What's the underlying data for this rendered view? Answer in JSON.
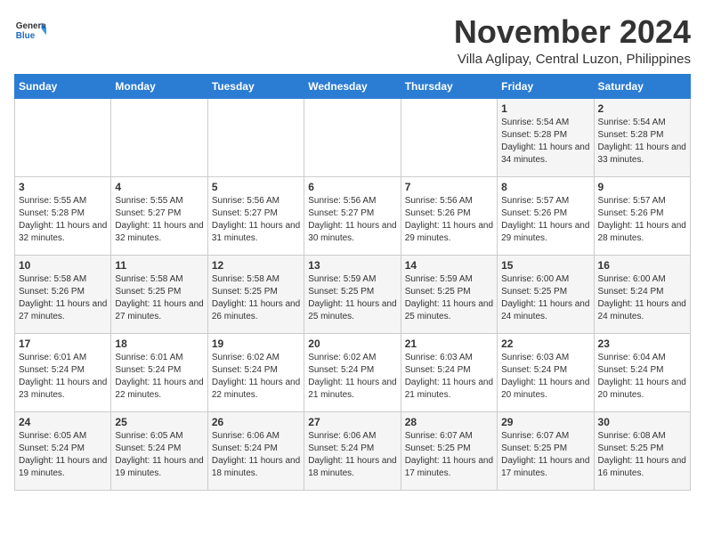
{
  "header": {
    "logo": {
      "general": "General",
      "blue": "Blue"
    },
    "title": "November 2024",
    "location": "Villa Aglipay, Central Luzon, Philippines"
  },
  "weekdays": [
    "Sunday",
    "Monday",
    "Tuesday",
    "Wednesday",
    "Thursday",
    "Friday",
    "Saturday"
  ],
  "weeks": [
    [
      {
        "day": "",
        "info": ""
      },
      {
        "day": "",
        "info": ""
      },
      {
        "day": "",
        "info": ""
      },
      {
        "day": "",
        "info": ""
      },
      {
        "day": "",
        "info": ""
      },
      {
        "day": "1",
        "info": "Sunrise: 5:54 AM\nSunset: 5:28 PM\nDaylight: 11 hours and 34 minutes."
      },
      {
        "day": "2",
        "info": "Sunrise: 5:54 AM\nSunset: 5:28 PM\nDaylight: 11 hours and 33 minutes."
      }
    ],
    [
      {
        "day": "3",
        "info": "Sunrise: 5:55 AM\nSunset: 5:28 PM\nDaylight: 11 hours and 32 minutes."
      },
      {
        "day": "4",
        "info": "Sunrise: 5:55 AM\nSunset: 5:27 PM\nDaylight: 11 hours and 32 minutes."
      },
      {
        "day": "5",
        "info": "Sunrise: 5:56 AM\nSunset: 5:27 PM\nDaylight: 11 hours and 31 minutes."
      },
      {
        "day": "6",
        "info": "Sunrise: 5:56 AM\nSunset: 5:27 PM\nDaylight: 11 hours and 30 minutes."
      },
      {
        "day": "7",
        "info": "Sunrise: 5:56 AM\nSunset: 5:26 PM\nDaylight: 11 hours and 29 minutes."
      },
      {
        "day": "8",
        "info": "Sunrise: 5:57 AM\nSunset: 5:26 PM\nDaylight: 11 hours and 29 minutes."
      },
      {
        "day": "9",
        "info": "Sunrise: 5:57 AM\nSunset: 5:26 PM\nDaylight: 11 hours and 28 minutes."
      }
    ],
    [
      {
        "day": "10",
        "info": "Sunrise: 5:58 AM\nSunset: 5:26 PM\nDaylight: 11 hours and 27 minutes."
      },
      {
        "day": "11",
        "info": "Sunrise: 5:58 AM\nSunset: 5:25 PM\nDaylight: 11 hours and 27 minutes."
      },
      {
        "day": "12",
        "info": "Sunrise: 5:58 AM\nSunset: 5:25 PM\nDaylight: 11 hours and 26 minutes."
      },
      {
        "day": "13",
        "info": "Sunrise: 5:59 AM\nSunset: 5:25 PM\nDaylight: 11 hours and 25 minutes."
      },
      {
        "day": "14",
        "info": "Sunrise: 5:59 AM\nSunset: 5:25 PM\nDaylight: 11 hours and 25 minutes."
      },
      {
        "day": "15",
        "info": "Sunrise: 6:00 AM\nSunset: 5:25 PM\nDaylight: 11 hours and 24 minutes."
      },
      {
        "day": "16",
        "info": "Sunrise: 6:00 AM\nSunset: 5:24 PM\nDaylight: 11 hours and 24 minutes."
      }
    ],
    [
      {
        "day": "17",
        "info": "Sunrise: 6:01 AM\nSunset: 5:24 PM\nDaylight: 11 hours and 23 minutes."
      },
      {
        "day": "18",
        "info": "Sunrise: 6:01 AM\nSunset: 5:24 PM\nDaylight: 11 hours and 22 minutes."
      },
      {
        "day": "19",
        "info": "Sunrise: 6:02 AM\nSunset: 5:24 PM\nDaylight: 11 hours and 22 minutes."
      },
      {
        "day": "20",
        "info": "Sunrise: 6:02 AM\nSunset: 5:24 PM\nDaylight: 11 hours and 21 minutes."
      },
      {
        "day": "21",
        "info": "Sunrise: 6:03 AM\nSunset: 5:24 PM\nDaylight: 11 hours and 21 minutes."
      },
      {
        "day": "22",
        "info": "Sunrise: 6:03 AM\nSunset: 5:24 PM\nDaylight: 11 hours and 20 minutes."
      },
      {
        "day": "23",
        "info": "Sunrise: 6:04 AM\nSunset: 5:24 PM\nDaylight: 11 hours and 20 minutes."
      }
    ],
    [
      {
        "day": "24",
        "info": "Sunrise: 6:05 AM\nSunset: 5:24 PM\nDaylight: 11 hours and 19 minutes."
      },
      {
        "day": "25",
        "info": "Sunrise: 6:05 AM\nSunset: 5:24 PM\nDaylight: 11 hours and 19 minutes."
      },
      {
        "day": "26",
        "info": "Sunrise: 6:06 AM\nSunset: 5:24 PM\nDaylight: 11 hours and 18 minutes."
      },
      {
        "day": "27",
        "info": "Sunrise: 6:06 AM\nSunset: 5:24 PM\nDaylight: 11 hours and 18 minutes."
      },
      {
        "day": "28",
        "info": "Sunrise: 6:07 AM\nSunset: 5:25 PM\nDaylight: 11 hours and 17 minutes."
      },
      {
        "day": "29",
        "info": "Sunrise: 6:07 AM\nSunset: 5:25 PM\nDaylight: 11 hours and 17 minutes."
      },
      {
        "day": "30",
        "info": "Sunrise: 6:08 AM\nSunset: 5:25 PM\nDaylight: 11 hours and 16 minutes."
      }
    ]
  ]
}
